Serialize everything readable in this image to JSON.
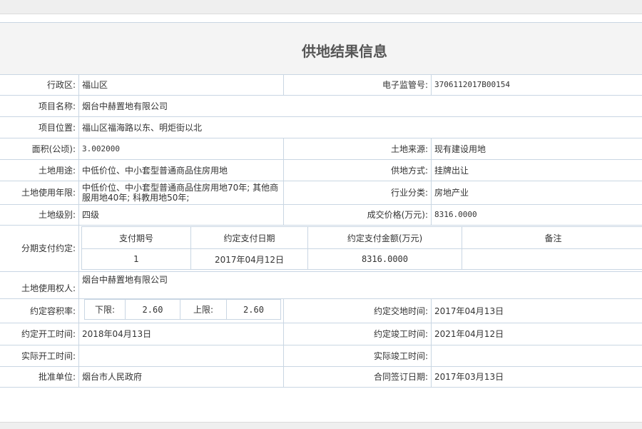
{
  "page": {
    "title": "供地结果信息"
  },
  "fields": {
    "district_label": "行政区:",
    "district_value": "福山区",
    "supervision_no_label": "电子监管号:",
    "supervision_no_value": "3706112017B00154",
    "project_name_label": "项目名称:",
    "project_name_value": "烟台中赫置地有限公司",
    "project_location_label": "项目位置:",
    "project_location_value": "福山区福海路以东、明炬街以北",
    "area_label": "面积(公顷):",
    "area_value": "3.002000",
    "land_source_label": "土地来源:",
    "land_source_value": "现有建设用地",
    "land_use_label": "土地用途:",
    "land_use_value": "中低价位、中小套型普通商品住房用地",
    "supply_method_label": "供地方式:",
    "supply_method_value": "挂牌出让",
    "use_term_label": "土地使用年限:",
    "use_term_value": "中低价位、中小套型普通商品住房用地70年; 其他商服用地40年; 科教用地50年;",
    "industry_label": "行业分类:",
    "industry_value": "房地产业",
    "land_grade_label": "土地级别:",
    "land_grade_value": "四级",
    "price_label": "成交价格(万元):",
    "price_value": "8316.0000",
    "installment_label": "分期支付约定:",
    "land_user_label": "土地使用权人:",
    "land_user_value": "烟台中赫置地有限公司",
    "plot_ratio_label": "约定容积率:",
    "handover_time_label": "约定交地时间:",
    "handover_time_value": "2017年04月13日",
    "start_time_label": "约定开工时间:",
    "start_time_value": "2018年04月13日",
    "finish_time_label": "约定竣工时间:",
    "finish_time_value": "2021年04月12日",
    "actual_start_label": "实际开工时间:",
    "actual_start_value": "",
    "actual_finish_label": "实际竣工时间:",
    "actual_finish_value": "",
    "approval_unit_label": "批准单位:",
    "approval_unit_value": "烟台市人民政府",
    "contract_date_label": "合同签订日期:",
    "contract_date_value": "2017年03月13日"
  },
  "installments": {
    "headers": [
      "支付期号",
      "约定支付日期",
      "约定支付金额(万元)",
      "备注"
    ],
    "rows": [
      {
        "period": "1",
        "date": "2017年04月12日",
        "amount": "8316.0000",
        "note": ""
      }
    ]
  },
  "plot_ratio": {
    "lower_label": "下限:",
    "lower_value": "2.60",
    "upper_label": "上限:",
    "upper_value": "2.60"
  }
}
